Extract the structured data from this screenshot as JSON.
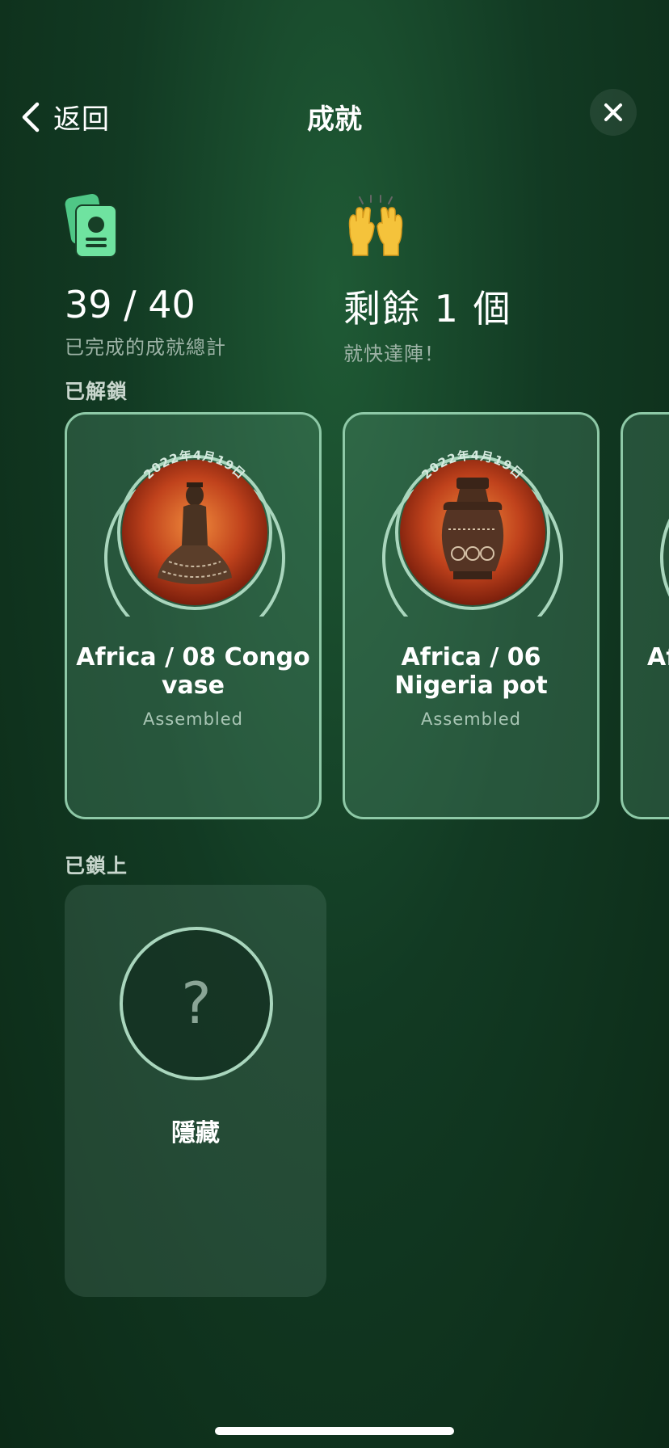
{
  "nav": {
    "back_label": "返回",
    "title": "成就"
  },
  "stats": {
    "completed": "39 / 40",
    "completed_caption": "已完成的成就總計",
    "remaining": "剩餘 1 個",
    "remaining_caption": "就快達陣！"
  },
  "unlocked": {
    "heading": "已解鎖",
    "items": [
      {
        "date": "2022年4月19日",
        "name": "Africa / 08 Congo vase",
        "status": "Assembled"
      },
      {
        "date": "2022年4月19日",
        "name": "Africa / 06 Nigeria pot",
        "status": "Assembled"
      },
      {
        "name": "Af"
      }
    ]
  },
  "locked": {
    "heading": "已鎖上",
    "items": [
      {
        "symbol": "?",
        "label": "隱藏"
      }
    ]
  },
  "colors": {
    "accent": "#8ec9a7",
    "icon_green": "#6fe3a0",
    "background": "#123a23"
  }
}
